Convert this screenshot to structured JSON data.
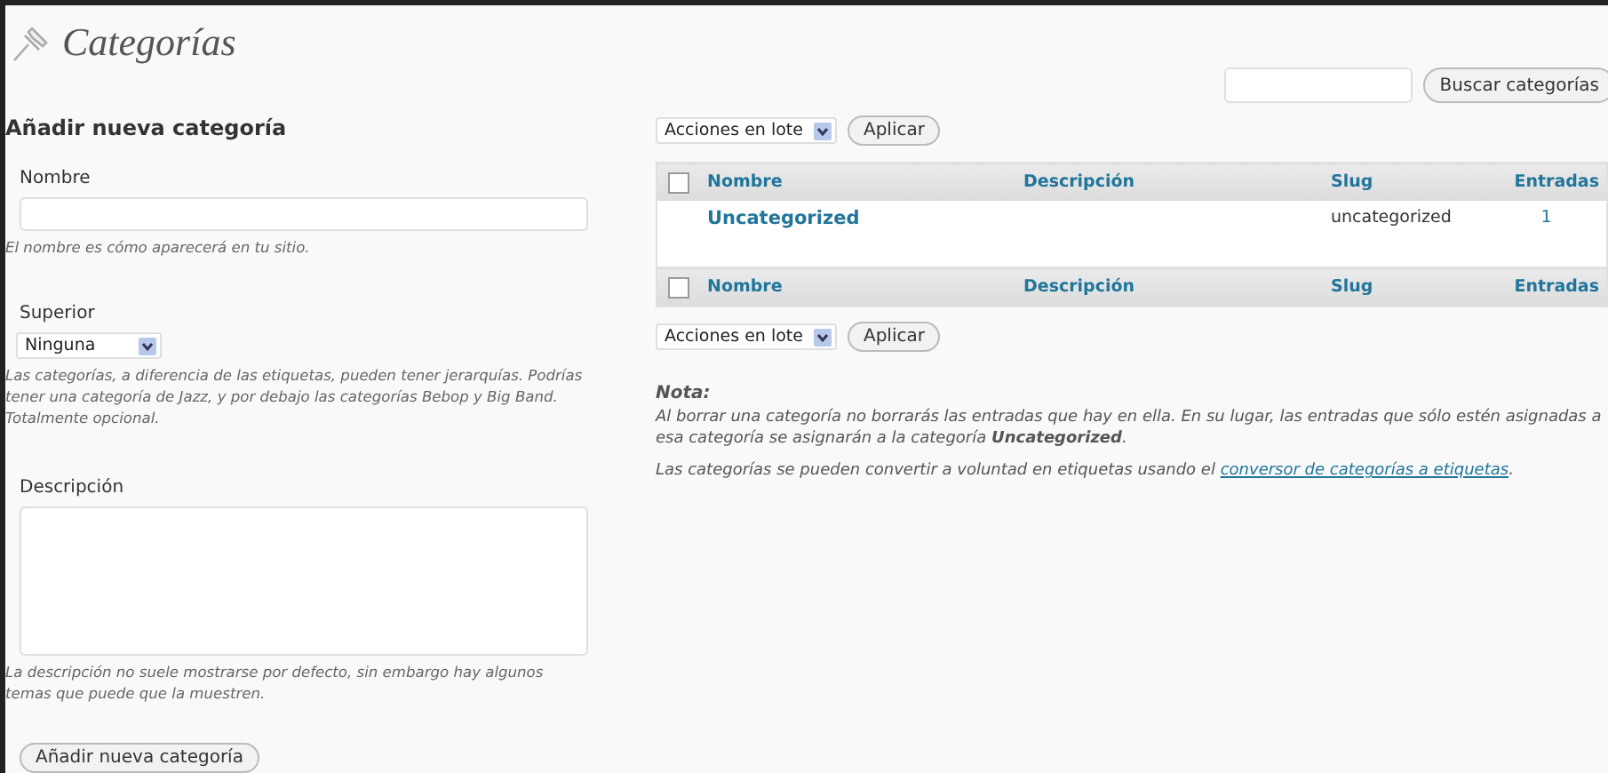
{
  "title": "Categorías",
  "search": {
    "button": "Buscar categorías"
  },
  "add_form": {
    "heading": "Añadir nueva categoría",
    "fields": [
      {
        "kind": "text",
        "label": "Nombre",
        "hint": "El nombre es cómo aparecerá en tu sitio."
      },
      {
        "kind": "select",
        "label": "Superior",
        "value": "Ninguna",
        "hint": "Las categorías, a diferencia de las etiquetas, pueden tener jerarquías. Podrías tener una categoría de Jazz, y por debajo las categorías Bebop y Big Band. Totalmente opcional."
      },
      {
        "kind": "textarea",
        "label": "Descripción",
        "hint": "La descripción no suele mostrarse por defecto, sin embargo hay algunos temas que puede que la muestren."
      }
    ],
    "submit": "Añadir nueva categoría"
  },
  "bulk_top": {
    "select": "Acciones en lote",
    "button": "Aplicar"
  },
  "table": {
    "columns": [
      "Nombre",
      "Descripción",
      "Slug",
      "Entradas"
    ],
    "footer_columns": [
      "Nombre",
      "Descripción",
      "Slug",
      "Entradas"
    ],
    "header_checked": false,
    "footer_checked": false,
    "rows": [
      {
        "name": "Uncategorized",
        "slug": "uncategorized",
        "count": "1"
      }
    ]
  },
  "bulk_bottom": {
    "select": "Acciones en lote",
    "button": "Aplicar"
  },
  "note": {
    "heading": "Nota:",
    "text": "Al borrar una categoría no borrarás las entradas que hay en ella. En su lugar, las entradas que sólo estén asignadas a esa categoría se asignarán a la categoría **Uncategorized**.",
    "convert_before": "Las categorías se pueden convertir a voluntad en etiquetas usando el",
    "convert_link": "conversor de categorías a etiquetas",
    "convert_after": "."
  }
}
